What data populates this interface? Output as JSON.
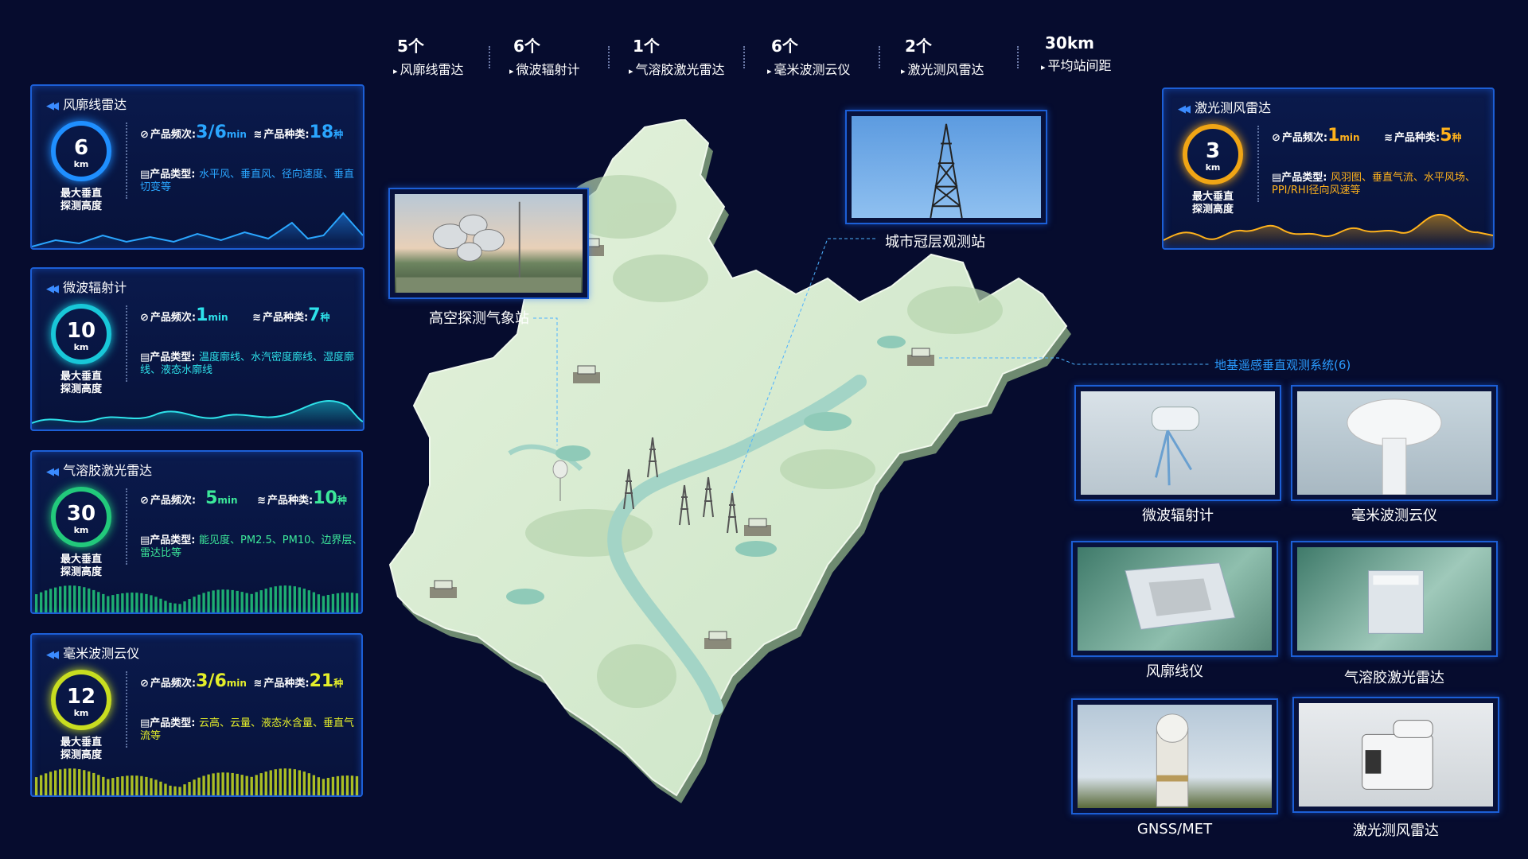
{
  "top_stats": [
    {
      "num": "5个",
      "label": "风廓线雷达"
    },
    {
      "num": "6个",
      "label": "微波辐射计"
    },
    {
      "num": "1个",
      "label": "气溶胶激光雷达"
    },
    {
      "num": "6个",
      "label": "毫米波测云仪"
    },
    {
      "num": "2个",
      "label": "激光测风雷达"
    },
    {
      "num": "30km",
      "label": "平均站间距"
    }
  ],
  "common": {
    "freq_label": "产品频次:",
    "kind_label": "产品种类:",
    "type_label": "产品类型:",
    "ring_caption_1": "最大垂直",
    "ring_caption_2": "探测高度",
    "unit_km": "km",
    "unit_min": "min",
    "unit_kind": "种"
  },
  "panels": {
    "wind_profiler": {
      "title": "风廓线雷达",
      "height": "6",
      "freq": "3/6",
      "kinds": "18",
      "types": "水平风、垂直风、径向速度、垂直切变等",
      "color": "#1f8fff"
    },
    "microwave": {
      "title": "微波辐射计",
      "height": "10",
      "freq": "1",
      "kinds": "7",
      "types": "温度廓线、水汽密度廓线、湿度廓线、液态水廓线",
      "color": "#18c7d8"
    },
    "aerosol": {
      "title": "气溶胶激光雷达",
      "height": "30",
      "freq": "5",
      "kinds": "10",
      "types": "能见度、PM2.5、PM10、边界层、雷达比等",
      "color": "#22c97b"
    },
    "mmwave": {
      "title": "毫米波测云仪",
      "height": "12",
      "freq": "3/6",
      "kinds": "21",
      "types": "云高、云量、液态水含量、垂直气流等",
      "color": "#c8dd20"
    },
    "wind_lidar": {
      "title": "激光测风雷达",
      "height": "3",
      "freq": "1",
      "kinds": "5",
      "types": "风羽图、垂直气流、水平风场、PPI/RHI径向风速等",
      "color": "#f0a515"
    }
  },
  "callouts": {
    "upper_air": "高空探测气象站",
    "urban_canopy": "城市冠层观测站",
    "ground_system": "地基遥感垂直观测系统(6)"
  },
  "gallery": [
    {
      "caption": "微波辐射计",
      "icon": "microwave-radiometer-photo"
    },
    {
      "caption": "毫米波测云仪",
      "icon": "cloud-radar-photo"
    },
    {
      "caption": "风廓线仪",
      "icon": "wind-profiler-photo"
    },
    {
      "caption": "气溶胶激光雷达",
      "icon": "aerosol-lidar-photo"
    },
    {
      "caption": "GNSS/MET",
      "icon": "gnss-met-photo"
    },
    {
      "caption": "激光测风雷达",
      "icon": "wind-lidar-photo"
    }
  ],
  "colors": {
    "background": "#060c2e",
    "panel_border": "#1c5fd6",
    "map_fill": "#d6ebcf",
    "accent_blue": "#2a9cff"
  }
}
